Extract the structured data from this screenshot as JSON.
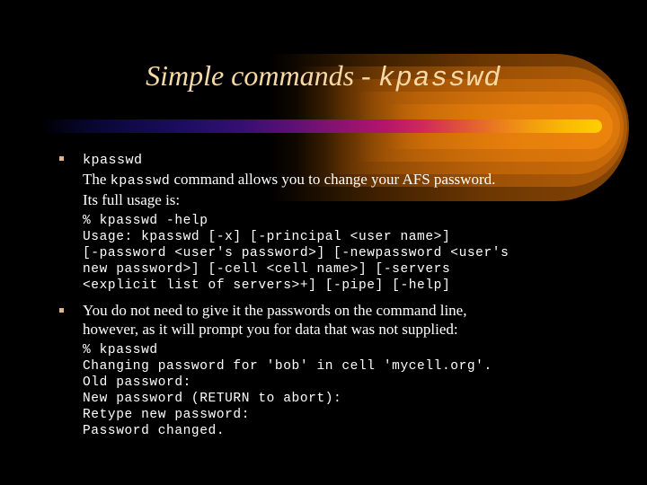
{
  "slide": {
    "title": {
      "serif_part": "Simple commands - ",
      "mono_part": "kpasswd"
    },
    "accent_bar_colors": {
      "start": "#000008",
      "mid_purple": "#5a1076",
      "mid_magenta": "#b4156a",
      "end_orange": "#ffc800"
    },
    "title_color": "#f7d9a6",
    "body_color": "#ffffff",
    "bullet_color": "#e3b483",
    "background_color": "#000000",
    "bullets": [
      {
        "marker": "square-bullet",
        "lines": [
          {
            "segments": [
              {
                "type": "mono",
                "text": "kpasswd"
              }
            ]
          },
          {
            "segments": [
              {
                "type": "serif",
                "text": "The "
              },
              {
                "type": "mono",
                "text": "kpasswd"
              },
              {
                "type": "serif",
                "text": " command allows you to change your AFS password."
              }
            ]
          },
          {
            "segments": [
              {
                "type": "serif",
                "text": "Its full usage is:"
              }
            ]
          }
        ],
        "code": "% kpasswd -help\nUsage: kpasswd [-x] [-principal <user name>]\n[-password <user's password>] [-newpassword <user's\nnew password>] [-cell <cell name>] [-servers\n<explicit list of servers>+] [-pipe] [-help]"
      },
      {
        "marker": "square-bullet",
        "lines": [
          {
            "segments": [
              {
                "type": "serif",
                "text": "You do not need to give it the passwords on the command line,"
              }
            ]
          },
          {
            "segments": [
              {
                "type": "serif",
                "text": "however, as it will prompt you for data that was not supplied:"
              }
            ]
          }
        ],
        "code": "% kpasswd\nChanging password for 'bob' in cell 'mycell.org'.\nOld password:\nNew password (RETURN to abort):\nRetype new password:\nPassword changed."
      }
    ]
  }
}
